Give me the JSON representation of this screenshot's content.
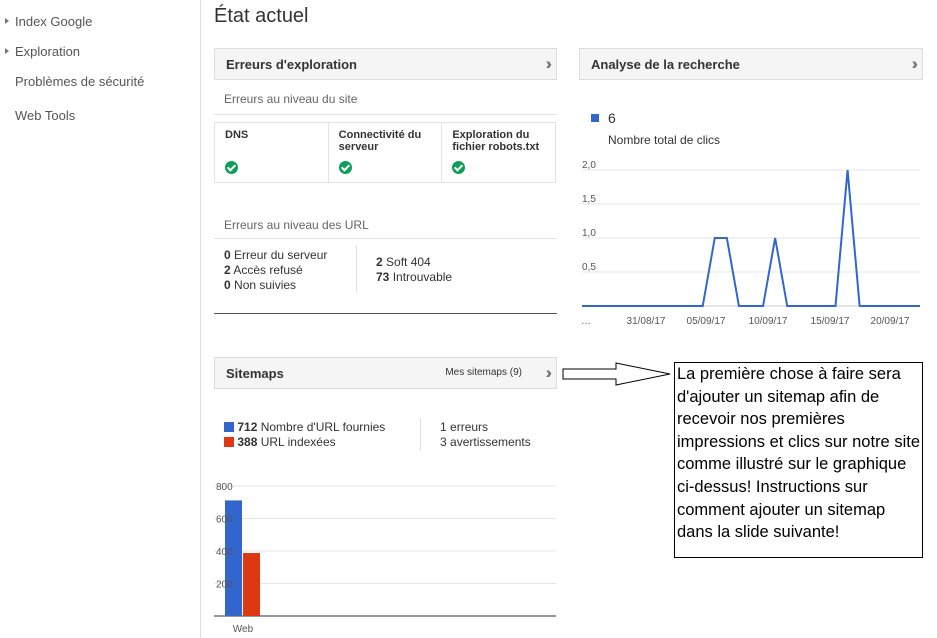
{
  "sidebar": {
    "items": [
      {
        "label": "Index Google",
        "expandable": true
      },
      {
        "label": "Exploration",
        "expandable": true
      },
      {
        "label": "Problèmes de sécurité",
        "expandable": false
      },
      {
        "label": "Web Tools",
        "expandable": false
      }
    ]
  },
  "page": {
    "title": "État actuel"
  },
  "crawl_errors": {
    "title": "Erreurs d'exploration",
    "site_level_label": "Erreurs au niveau du site",
    "site_checks": [
      {
        "label": "DNS",
        "status": "ok"
      },
      {
        "label": "Connectivité du serveur",
        "status": "ok"
      },
      {
        "label": "Exploration du fichier robots.txt",
        "status": "ok"
      }
    ],
    "url_level_label": "Erreurs au niveau des URL",
    "url_errors_left": [
      {
        "count": "0",
        "label": "Erreur du serveur"
      },
      {
        "count": "2",
        "label": "Accès refusé"
      },
      {
        "count": "0",
        "label": "Non suivies"
      }
    ],
    "url_errors_right": [
      {
        "count": "2",
        "label": "Soft 404"
      },
      {
        "count": "73",
        "label": "Introuvable"
      }
    ]
  },
  "search_analysis": {
    "title": "Analyse de la recherche",
    "total_value": "6",
    "total_label": "Nombre total de clics"
  },
  "sitemaps": {
    "title": "Sitemaps",
    "link_label": "Mes sitemaps (9)",
    "submitted": {
      "count": "712",
      "label": "Nombre d'URL fournies"
    },
    "indexed": {
      "count": "388",
      "label": "URL indexées"
    },
    "errors": {
      "count": "1",
      "label": "erreurs"
    },
    "warnings": {
      "count": "3",
      "label": "avertissements"
    }
  },
  "callout": {
    "text": "La première chose à faire sera d'ajouter un sitemap afin de recevoir nos premières impressions et clics sur notre site comme illustré sur le graphique ci-dessus! Instructions sur comment ajouter un sitemap dans la slide suivante!"
  },
  "colors": {
    "blue": "#3366cc",
    "red": "#dc3912",
    "green": "#0f9d58"
  },
  "chart_data": [
    {
      "type": "line",
      "title": "",
      "series": [
        {
          "name": "Nombre total de clics",
          "color": "#3366cc",
          "values": [
            0,
            0,
            0,
            0,
            0,
            0,
            0,
            0,
            0,
            0,
            0,
            1,
            1,
            0,
            0,
            0,
            1,
            0,
            0,
            0,
            0,
            0,
            2,
            0,
            0,
            0,
            0,
            0,
            0
          ]
        }
      ],
      "x_tick_labels": [
        "…",
        "31/08/17",
        "05/09/17",
        "10/09/17",
        "15/09/17",
        "20/09/17"
      ],
      "y_tick_labels": [
        "0,5",
        "1,0",
        "1,5",
        "2,0"
      ],
      "ylim": [
        0,
        2.0
      ],
      "grid": true
    },
    {
      "type": "bar",
      "categories": [
        "Web"
      ],
      "series": [
        {
          "name": "Nombre d'URL fournies",
          "color": "#3366cc",
          "values": [
            712
          ]
        },
        {
          "name": "URL indexées",
          "color": "#dc3912",
          "values": [
            388
          ]
        }
      ],
      "y_tick_labels": [
        "200",
        "400",
        "600",
        "800"
      ],
      "ylim": [
        0,
        800
      ],
      "grid": true
    }
  ]
}
